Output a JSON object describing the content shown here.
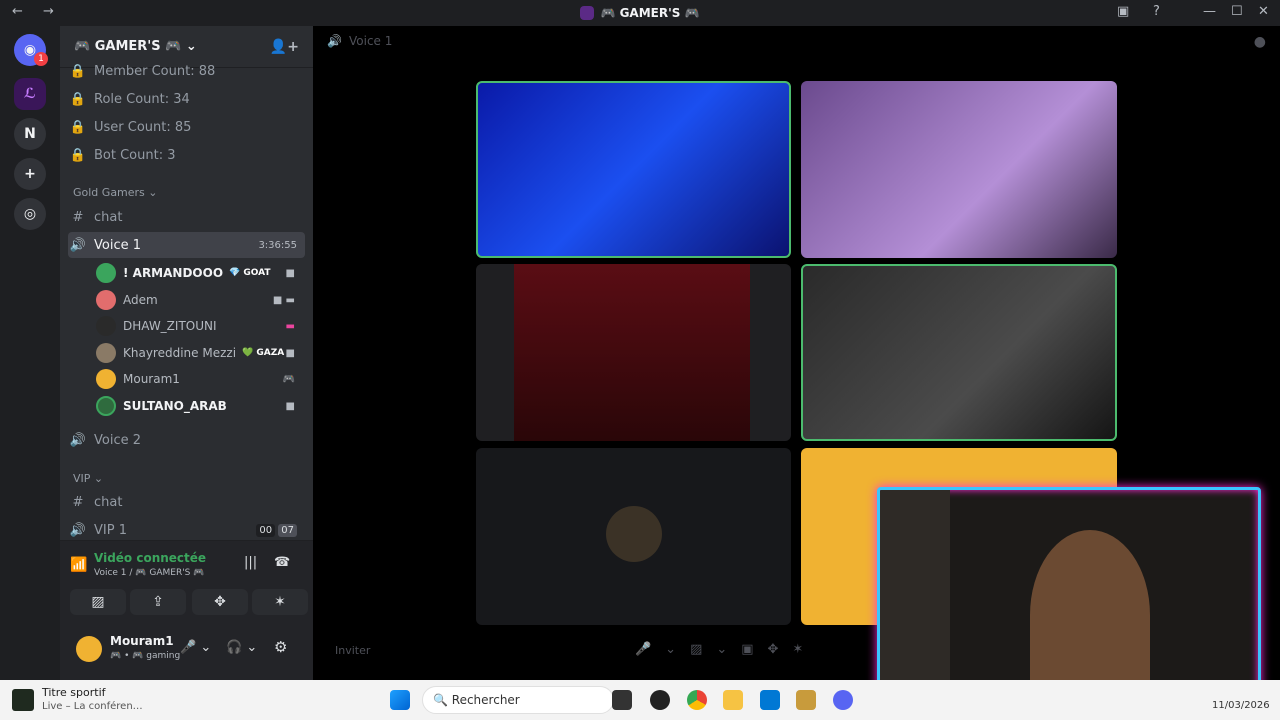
{
  "window": {
    "title": "🎮 GAMER'S 🎮",
    "back_icon": "arrow-left-icon",
    "forward_icon": "arrow-right-icon"
  },
  "guilds": {
    "notification_badge": "1",
    "items": [
      "N"
    ]
  },
  "server": {
    "name": "🎮 GAMER'S 🎮",
    "stats": [
      {
        "label": "Member Count: 88"
      },
      {
        "label": "Role Count: 34"
      },
      {
        "label": "User Count: 85"
      },
      {
        "label": "Bot Count: 3"
      }
    ],
    "categories": [
      {
        "name": "Gold Gamers ⌄"
      },
      {
        "name": "VIP ⌄"
      }
    ],
    "channels": {
      "chat": "chat",
      "voice1": "Voice 1",
      "voice1_timer": "3:36:55",
      "voice2": "Voice 2",
      "vip_chat": "chat",
      "vip1": "VIP 1",
      "vip1_count_a": "00",
      "vip1_count_b": "07"
    },
    "members": [
      {
        "name": "! ARMANDOOO",
        "tag": "💎 GOAT",
        "color": "#3ba55d"
      },
      {
        "name": "Adem",
        "tag": "",
        "color": "#e26d6d"
      },
      {
        "name": "DHAW_ZITOUNI",
        "tag": "",
        "color": "#2a2a2a"
      },
      {
        "name": "Khayreddine Mezzi",
        "tag": "💚 GAZA",
        "color": "#8a7a66"
      },
      {
        "name": "Mouram1",
        "tag": "",
        "color": "#f0b232"
      },
      {
        "name": "SULTANO_ARAB",
        "tag": "",
        "color": "#2f6b3e"
      }
    ]
  },
  "voice_status": {
    "title": "Vidéo connectée",
    "subtitle": "Voice 1 / 🎮 GAMER'S 🎮"
  },
  "user": {
    "name": "Mouram1",
    "status": "🎮 • 🎮 gaming"
  },
  "main": {
    "channel_name": "Voice 1",
    "invite_label": "Inviter"
  },
  "taskbar": {
    "widget_title": "Titre sportif",
    "widget_sub": "Live – La conféren…",
    "search_placeholder": "Rechercher",
    "date": "11/03/2026"
  },
  "colors": {
    "active_border": "#4cbb6e",
    "accent": "#5865f2",
    "cam_border": "#39c6ff",
    "cam_glow": "#ff2bd6"
  }
}
